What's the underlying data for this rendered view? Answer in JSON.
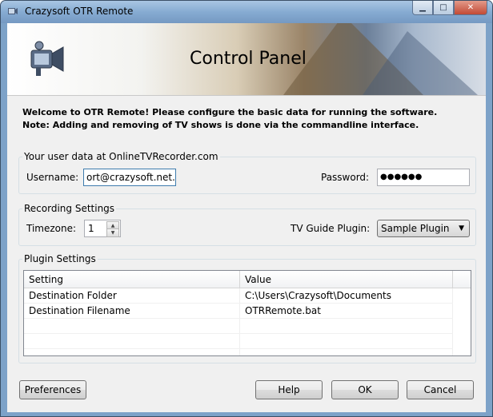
{
  "window": {
    "title": "Crazysoft OTR Remote"
  },
  "banner": {
    "title": "Control Panel"
  },
  "intro": {
    "line1": "Welcome to OTR Remote! Please configure the basic data for running the software.",
    "line2": "Note: Adding and removing of TV shows is done via the commandline interface."
  },
  "user_data": {
    "legend": "Your user data at OnlineTVRecorder.com",
    "username_label": "Username:",
    "username_value": "ort@crazysoft.net.ms",
    "password_label": "Password:",
    "password_value": "●●●●●●"
  },
  "recording": {
    "legend": "Recording Settings",
    "timezone_label": "Timezone:",
    "timezone_value": "1",
    "plugin_label": "TV Guide Plugin:",
    "plugin_value": "Sample Plugin"
  },
  "plugin_settings": {
    "legend": "Plugin Settings",
    "columns": [
      "Setting",
      "Value"
    ],
    "rows": [
      [
        "Destination Folder",
        "C:\\Users\\Crazysoft\\Documents"
      ],
      [
        "Destination Filename",
        "OTRRemote.bat"
      ]
    ]
  },
  "buttons": {
    "preferences": "Preferences",
    "help": "Help",
    "ok": "OK",
    "cancel": "Cancel"
  },
  "icons": {
    "app": "video-camera-icon",
    "minimize": "minimize-icon",
    "maximize": "maximize-icon",
    "close": "close-icon"
  }
}
